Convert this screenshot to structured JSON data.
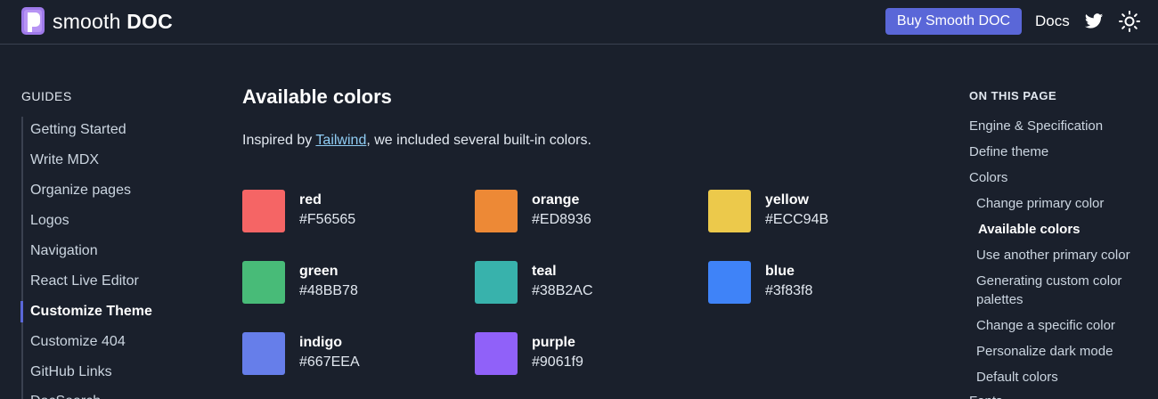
{
  "header": {
    "brand_light": "smooth",
    "brand_bold": "DOC",
    "buy_label": "Buy Smooth DOC",
    "docs_label": "Docs",
    "accent": "#5a67d8",
    "icons": [
      "twitter-icon",
      "sun-icon"
    ]
  },
  "sidebar": {
    "title": "GUIDES",
    "items": [
      {
        "label": "Getting Started"
      },
      {
        "label": "Write MDX"
      },
      {
        "label": "Organize pages"
      },
      {
        "label": "Logos"
      },
      {
        "label": "Navigation"
      },
      {
        "label": "React Live Editor"
      },
      {
        "label": "Customize Theme",
        "active": true
      },
      {
        "label": "Customize 404"
      },
      {
        "label": "GitHub Links"
      },
      {
        "label": "DocSearch"
      }
    ]
  },
  "main": {
    "title": "Available colors",
    "intro_prefix": "Inspired by ",
    "intro_link": "Tailwind",
    "intro_suffix": ", we included several built-in colors.",
    "colors": [
      {
        "name": "red",
        "hex": "#F56565"
      },
      {
        "name": "orange",
        "hex": "#ED8936"
      },
      {
        "name": "yellow",
        "hex": "#ECC94B"
      },
      {
        "name": "green",
        "hex": "#48BB78"
      },
      {
        "name": "teal",
        "hex": "#38B2AC"
      },
      {
        "name": "blue",
        "hex": "#3f83f8"
      },
      {
        "name": "indigo",
        "hex": "#667EEA"
      },
      {
        "name": "purple",
        "hex": "#9061f9"
      }
    ]
  },
  "toc": {
    "title": "ON THIS PAGE",
    "items": [
      {
        "label": "Engine & Specification",
        "level": 1
      },
      {
        "label": "Define theme",
        "level": 1
      },
      {
        "label": "Colors",
        "level": 1
      },
      {
        "label": "Change primary color",
        "level": 2
      },
      {
        "label": "Available colors",
        "level": 2,
        "active": true
      },
      {
        "label": "Use another primary color",
        "level": 2
      },
      {
        "label": "Generating custom color palettes",
        "level": 2
      },
      {
        "label": "Change a specific color",
        "level": 2
      },
      {
        "label": "Personalize dark mode",
        "level": 2
      },
      {
        "label": "Default colors",
        "level": 2
      },
      {
        "label": "Fonts",
        "level": 1
      }
    ]
  }
}
